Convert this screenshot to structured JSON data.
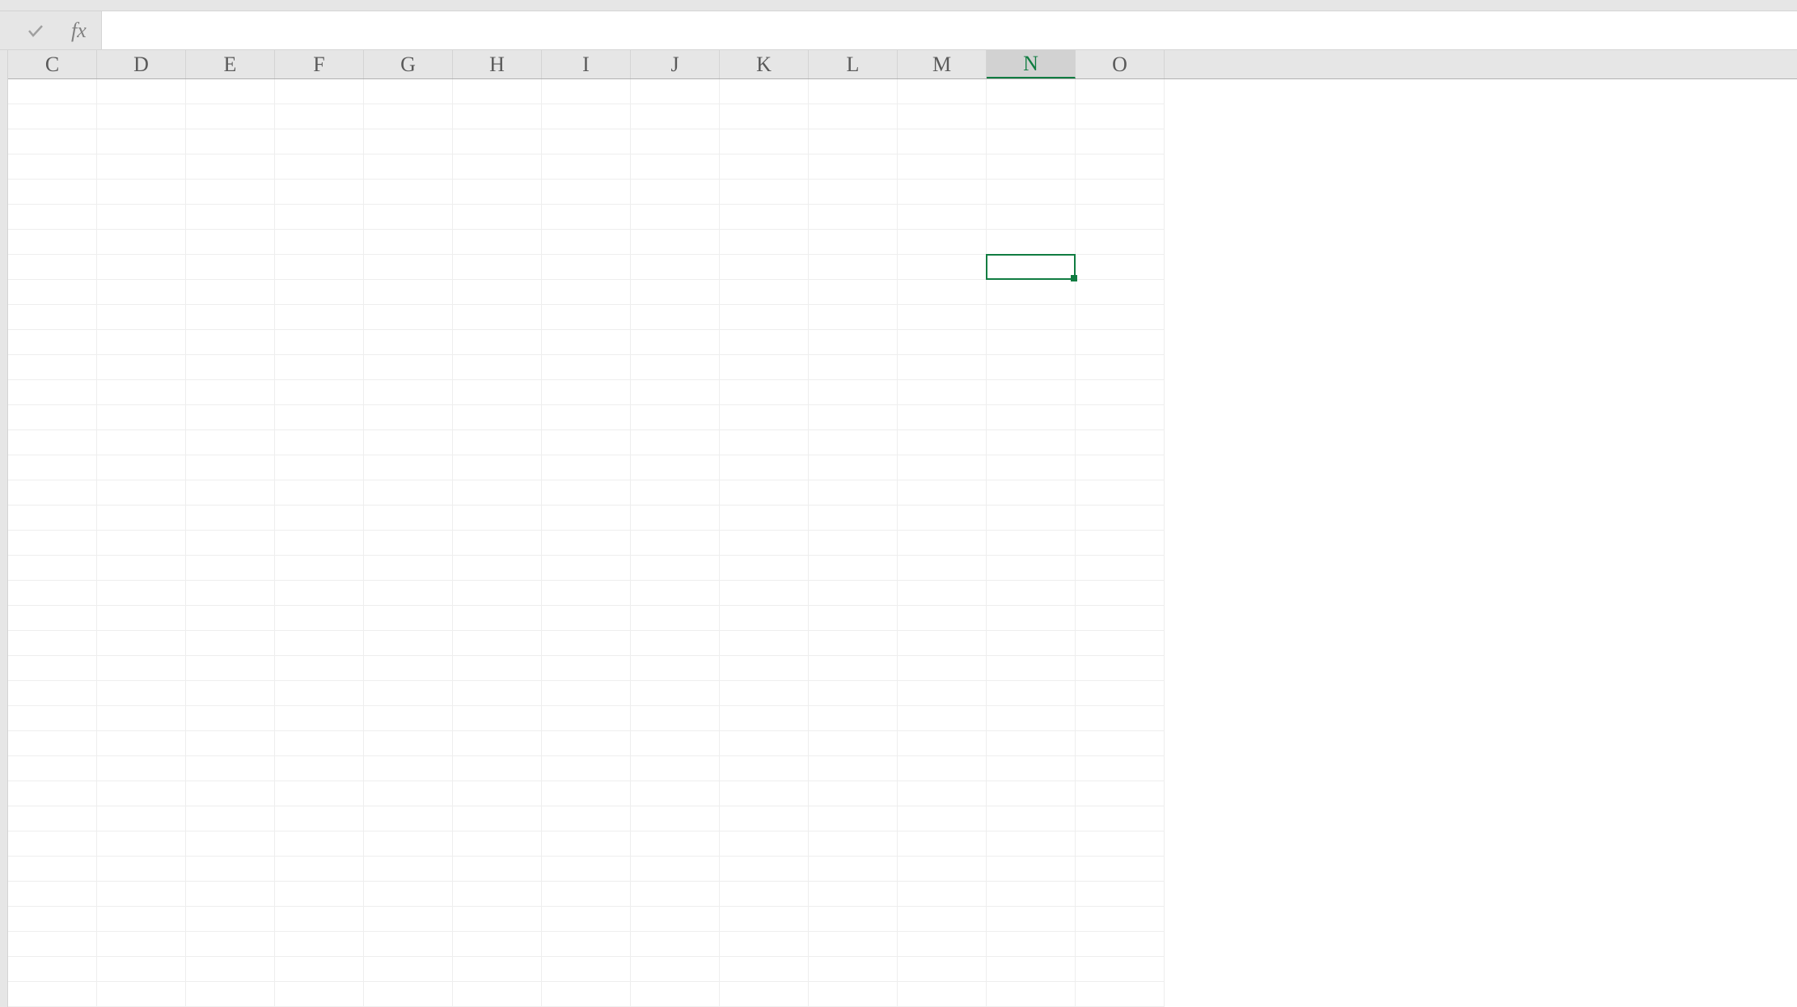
{
  "formula_bar": {
    "fx_label": "fx",
    "input_value": ""
  },
  "columns": [
    {
      "label": "C",
      "selected": false
    },
    {
      "label": "D",
      "selected": false
    },
    {
      "label": "E",
      "selected": false
    },
    {
      "label": "F",
      "selected": false
    },
    {
      "label": "G",
      "selected": false
    },
    {
      "label": "H",
      "selected": false
    },
    {
      "label": "I",
      "selected": false
    },
    {
      "label": "J",
      "selected": false
    },
    {
      "label": "K",
      "selected": false
    },
    {
      "label": "L",
      "selected": false
    },
    {
      "label": "M",
      "selected": false
    },
    {
      "label": "N",
      "selected": true
    },
    {
      "label": "O",
      "selected": false
    }
  ],
  "selection": {
    "column": "N",
    "col_index": 11,
    "row_index": 7
  },
  "visible_rows": 37,
  "colors": {
    "accent": "#107c41",
    "header_bg": "#e6e6e6",
    "grid_line": "#eeeeee",
    "border": "#d4d4d4"
  }
}
